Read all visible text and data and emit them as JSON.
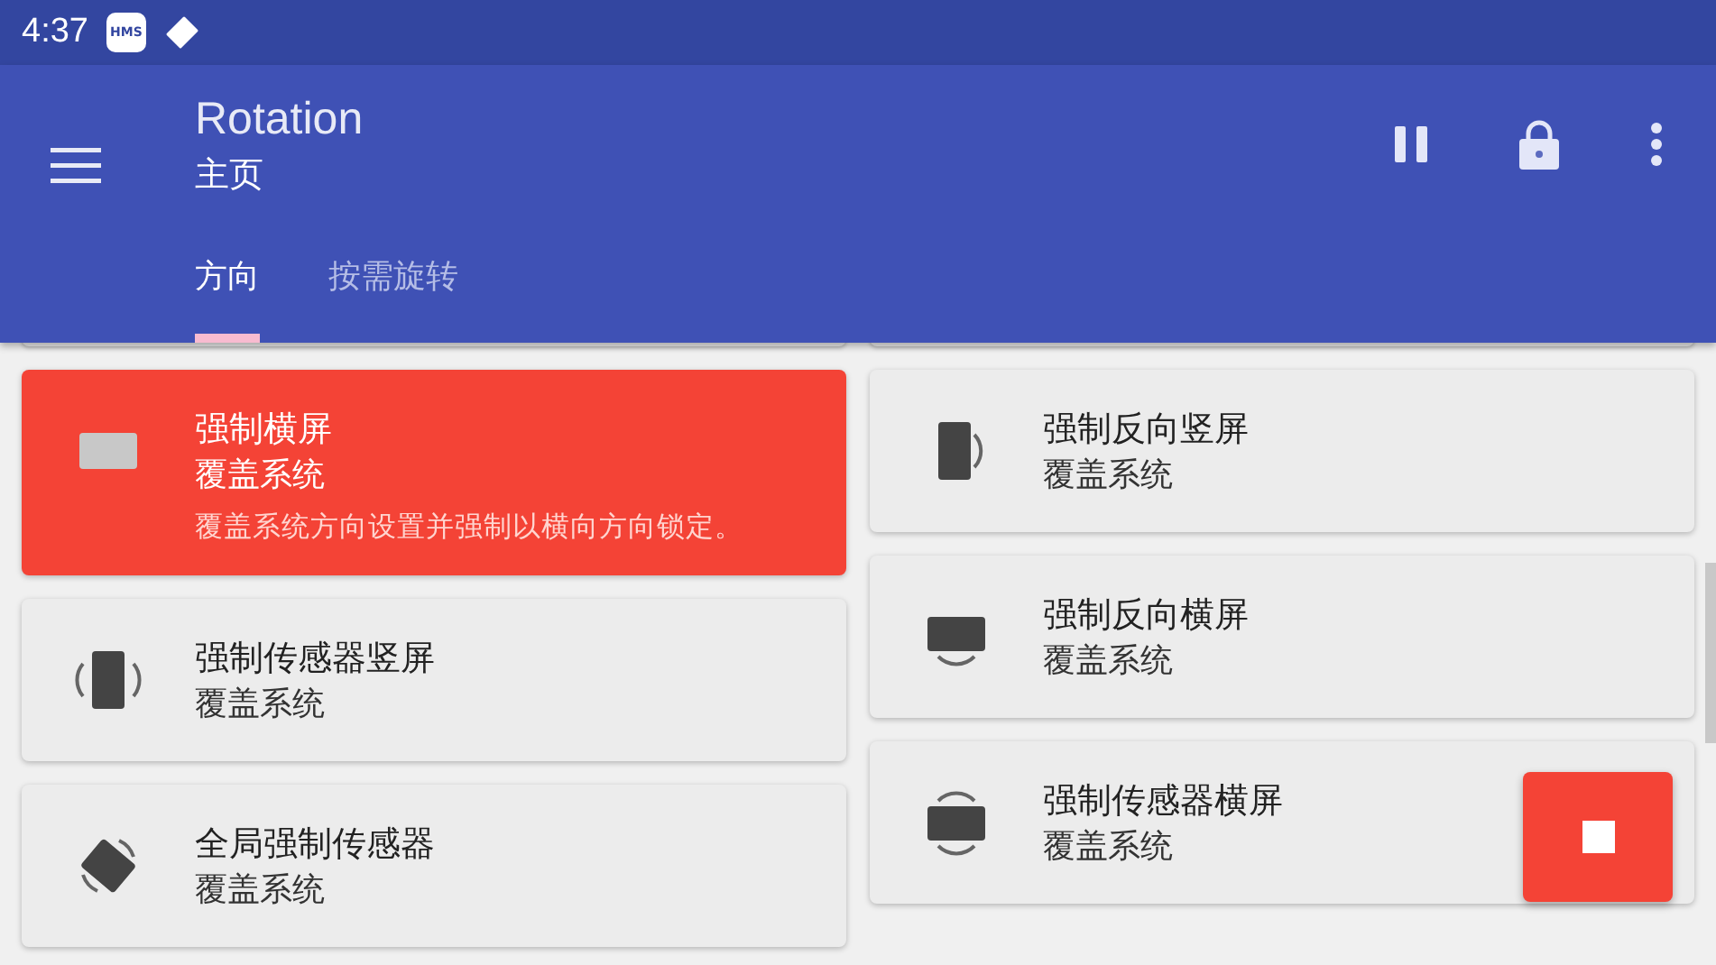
{
  "status_bar": {
    "time": "4:37",
    "badge": "HMS"
  },
  "app_bar": {
    "title": "Rotation",
    "subtitle": "主页"
  },
  "tabs": [
    {
      "label": "方向",
      "selected": true
    },
    {
      "label": "按需旋转",
      "selected": false
    }
  ],
  "columns": [
    {
      "cards": [
        {
          "kind": "landscape",
          "selected": true,
          "title": "强制横屏",
          "subtitle": "覆盖系统",
          "description": "覆盖系统方向设置并强制以横向方向锁定。"
        },
        {
          "kind": "portrait-sensor",
          "selected": false,
          "title": "强制传感器竖屏",
          "subtitle": "覆盖系统"
        },
        {
          "kind": "full-sensor",
          "selected": false,
          "title": "全局强制传感器",
          "subtitle": "覆盖系统"
        }
      ]
    },
    {
      "cards": [
        {
          "kind": "reverse-portrait",
          "selected": false,
          "title": "强制反向竖屏",
          "subtitle": "覆盖系统"
        },
        {
          "kind": "reverse-landscape",
          "selected": false,
          "title": "强制反向横屏",
          "subtitle": "覆盖系统"
        },
        {
          "kind": "landscape-sensor",
          "selected": false,
          "title": "强制传感器横屏",
          "subtitle": "覆盖系统"
        }
      ]
    }
  ]
}
